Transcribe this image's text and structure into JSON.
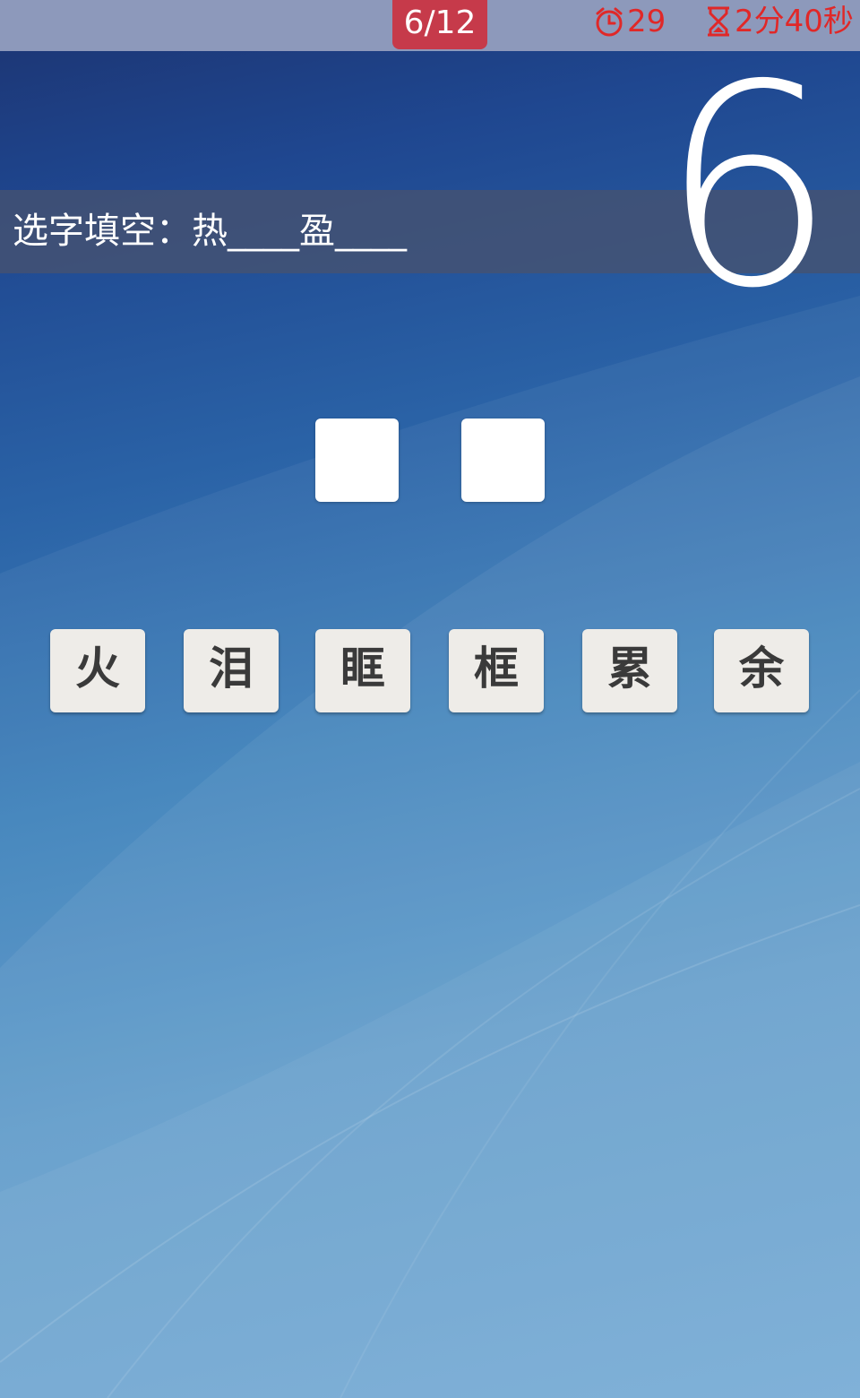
{
  "status_bar": {
    "progress": "6/12",
    "alarm_value": "29",
    "timer_value": "2分40秒",
    "accent_color": "#e02828",
    "badge_color": "#c63a4a",
    "alarm_icon": "alarm-clock-icon",
    "timer_icon": "hourglass-icon"
  },
  "question": {
    "text": "选字填空：热____盈____",
    "level_number": "6"
  },
  "answer_slots": [
    "",
    ""
  ],
  "choices": [
    "火",
    "泪",
    "眶",
    "框",
    "累",
    "余"
  ]
}
